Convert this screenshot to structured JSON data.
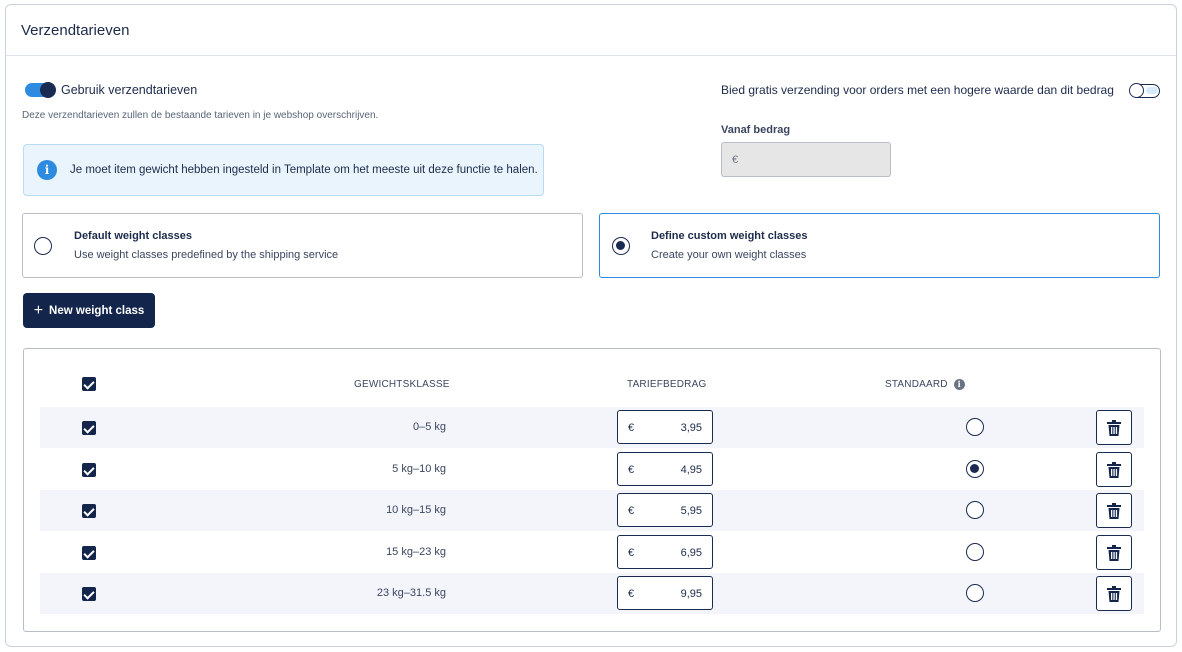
{
  "panel": {
    "title": "Verzendtarieven"
  },
  "shipping_toggle": {
    "label": "Gebruik verzendtarieven",
    "hint": "Deze verzendtarieven zullen de bestaande tarieven in je webshop overschrijven.",
    "enabled": true
  },
  "info": {
    "text": "Je moet item gewicht hebben ingesteld in Template om het meeste uit deze functie te halen."
  },
  "free_shipping": {
    "label": "Bied gratis verzending voor orders met een hogere waarde dan dit bedrag",
    "enabled": false,
    "amount_label": "Vanaf bedrag",
    "amount_placeholder": "€"
  },
  "options": [
    {
      "title": "Default weight classes",
      "description": "Use weight classes predefined by the shipping service",
      "selected": false
    },
    {
      "title": "Define custom weight classes",
      "description": "Create your own weight classes",
      "selected": true
    }
  ],
  "new_button": {
    "label": "New weight class"
  },
  "table": {
    "headers": {
      "class": "GEWICHTSKLASSE",
      "rate": "TARIEFBEDRAG",
      "default": "STANDAARD"
    },
    "currency": "€",
    "rows": [
      {
        "class": "0–5 kg",
        "rate": "3,95",
        "default": false,
        "checked": true
      },
      {
        "class": "5 kg–10 kg",
        "rate": "4,95",
        "default": true,
        "checked": true
      },
      {
        "class": "10 kg–15 kg",
        "rate": "5,95",
        "default": false,
        "checked": true
      },
      {
        "class": "15 kg–23 kg",
        "rate": "6,95",
        "default": false,
        "checked": true
      },
      {
        "class": "23 kg–31.5 kg",
        "rate": "9,95",
        "default": false,
        "checked": true
      }
    ]
  },
  "colors": {
    "navy": "#13254b",
    "accent": "#2d8ce0",
    "info_bg": "#e9f4fd"
  }
}
